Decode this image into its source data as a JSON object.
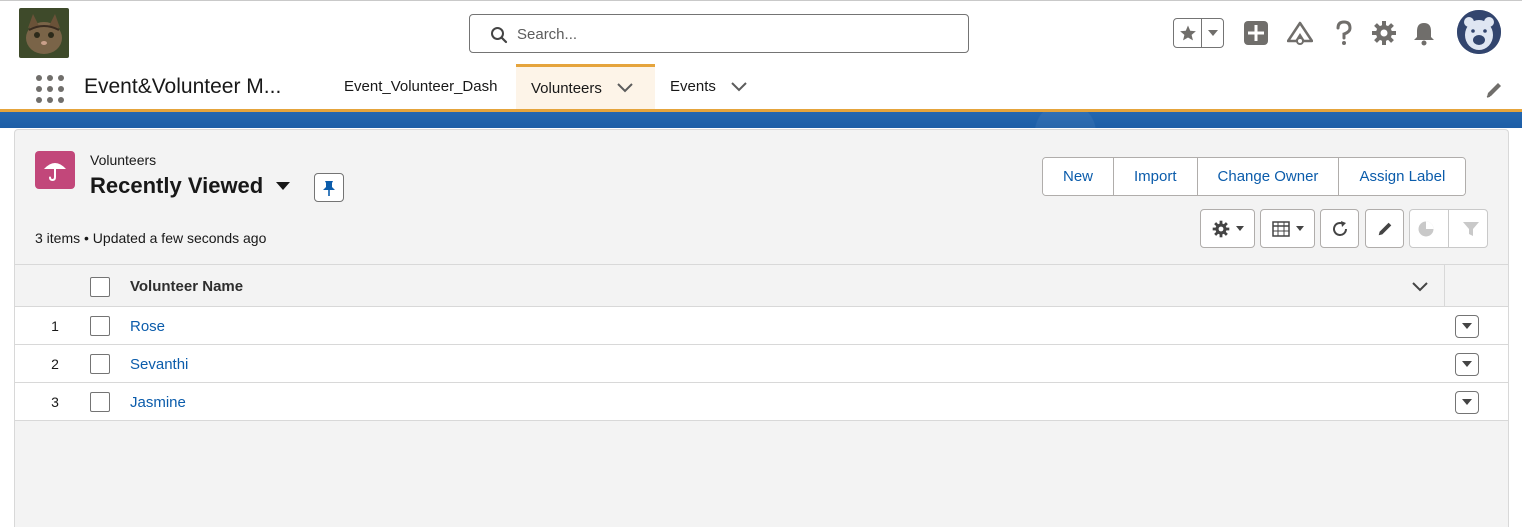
{
  "header": {
    "search_placeholder": "Search...",
    "icons": [
      "favorites-star-icon",
      "favorites-dropdown-icon",
      "global-add-icon",
      "trailhead-icon",
      "help-icon",
      "setup-gear-icon",
      "notifications-bell-icon",
      "user-avatar"
    ]
  },
  "nav": {
    "app_name": "Event&Volunteer M...",
    "tabs": [
      {
        "label": "Event_Volunteer_Dash"
      },
      {
        "label": "Volunteers"
      },
      {
        "label": "Events"
      }
    ]
  },
  "list_view": {
    "object_label": "Volunteers",
    "view_name": "Recently Viewed",
    "status": "3 items • Updated a few seconds ago",
    "actions": [
      "New",
      "Import",
      "Change Owner",
      "Assign Label"
    ],
    "columns": [
      "Volunteer Name"
    ],
    "rows": [
      {
        "num": "1",
        "name": "Rose"
      },
      {
        "num": "2",
        "name": "Sevanthi"
      },
      {
        "num": "3",
        "name": "Jasmine"
      }
    ]
  },
  "colors": {
    "accent": "#e5a43c",
    "link": "#0b5cab",
    "object_icon": "#c2477a",
    "band": "#1f5ea8"
  }
}
